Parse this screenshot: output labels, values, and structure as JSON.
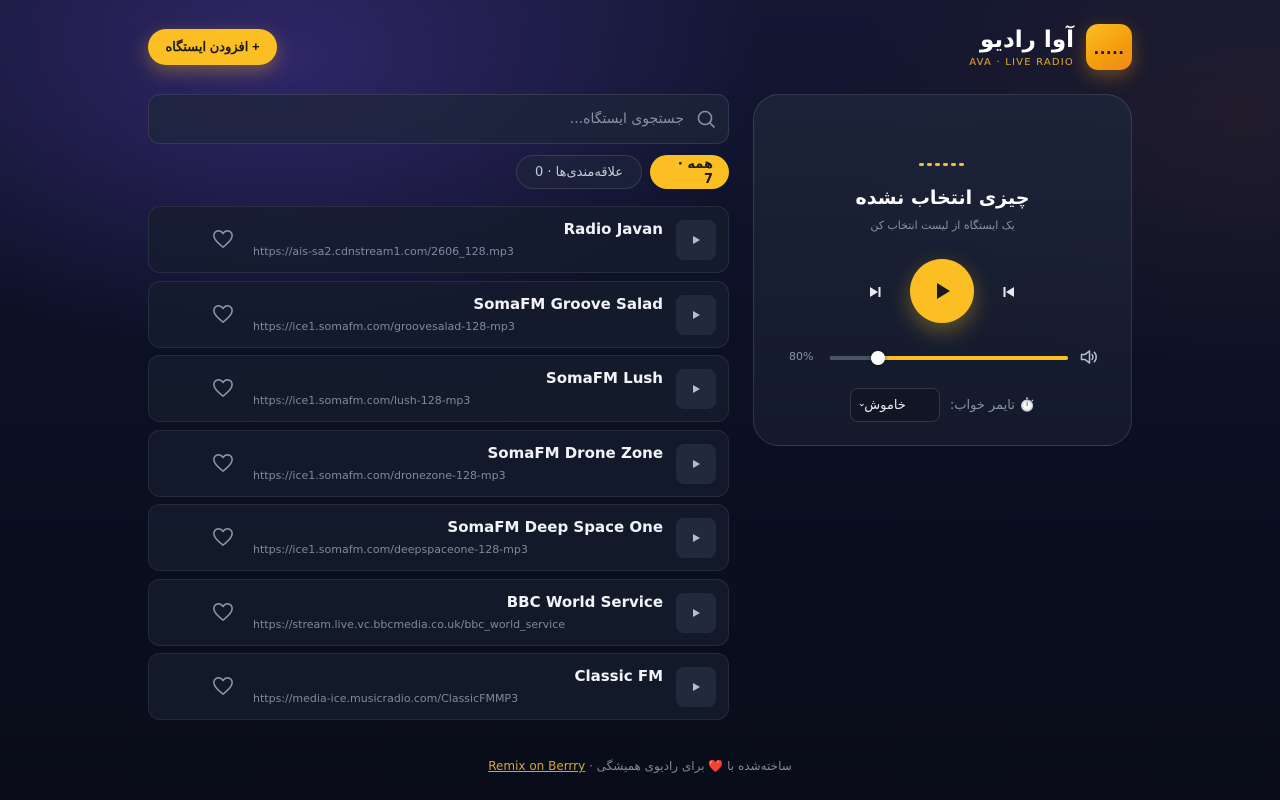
{
  "header": {
    "title": "آوا رادیو",
    "subtitle": "AVA · LIVE RADIO",
    "logo_glyph": ".....",
    "add_button_label": "+ افزودن ایستگاه"
  },
  "search": {
    "placeholder": "جستجوی ایستگاه..."
  },
  "filters": [
    {
      "label": "همه · 7",
      "active": true
    },
    {
      "label": "علاقه‌مندی‌ها · 0",
      "active": false
    }
  ],
  "stations": [
    {
      "name": "Radio Javan",
      "url": "https://ais-sa2.cdnstream1.com/2606_128.mp3"
    },
    {
      "name": "SomaFM Groove Salad",
      "url": "https://ice1.somafm.com/groovesalad-128-mp3"
    },
    {
      "name": "SomaFM Lush",
      "url": "https://ice1.somafm.com/lush-128-mp3"
    },
    {
      "name": "SomaFM Drone Zone",
      "url": "https://ice1.somafm.com/dronezone-128-mp3"
    },
    {
      "name": "SomaFM Deep Space One",
      "url": "https://ice1.somafm.com/deepspaceone-128-mp3"
    },
    {
      "name": "BBC World Service",
      "url": "https://stream.live.vc.bbcmedia.co.uk/bbc_world_service"
    },
    {
      "name": "Classic FM",
      "url": "https://media-ice.musicradio.com/ClassicFMMP3"
    }
  ],
  "player": {
    "title": "چیزی انتخاب نشده",
    "subtitle": "یک ایستگاه از لیست انتخاب کن",
    "volume_label": "80%",
    "volume_fraction": 0.8,
    "timer_label": "⏱️ تایمر خواب:",
    "timer_value": "خاموش"
  },
  "footer": {
    "text": "ساخته‌شده با ❤️ برای رادیوی همیشگی · ",
    "link_label": "Remix on Berrry"
  },
  "colors": {
    "accent": "#fbbf24",
    "background": "#0c1024"
  },
  "icons": {
    "search": "search-icon",
    "play": "play-icon",
    "heart": "heart-icon",
    "skip_next": "skip-next-icon",
    "skip_previous": "skip-previous-icon",
    "volume": "volume-icon",
    "chevron": "chevron-down-icon"
  }
}
